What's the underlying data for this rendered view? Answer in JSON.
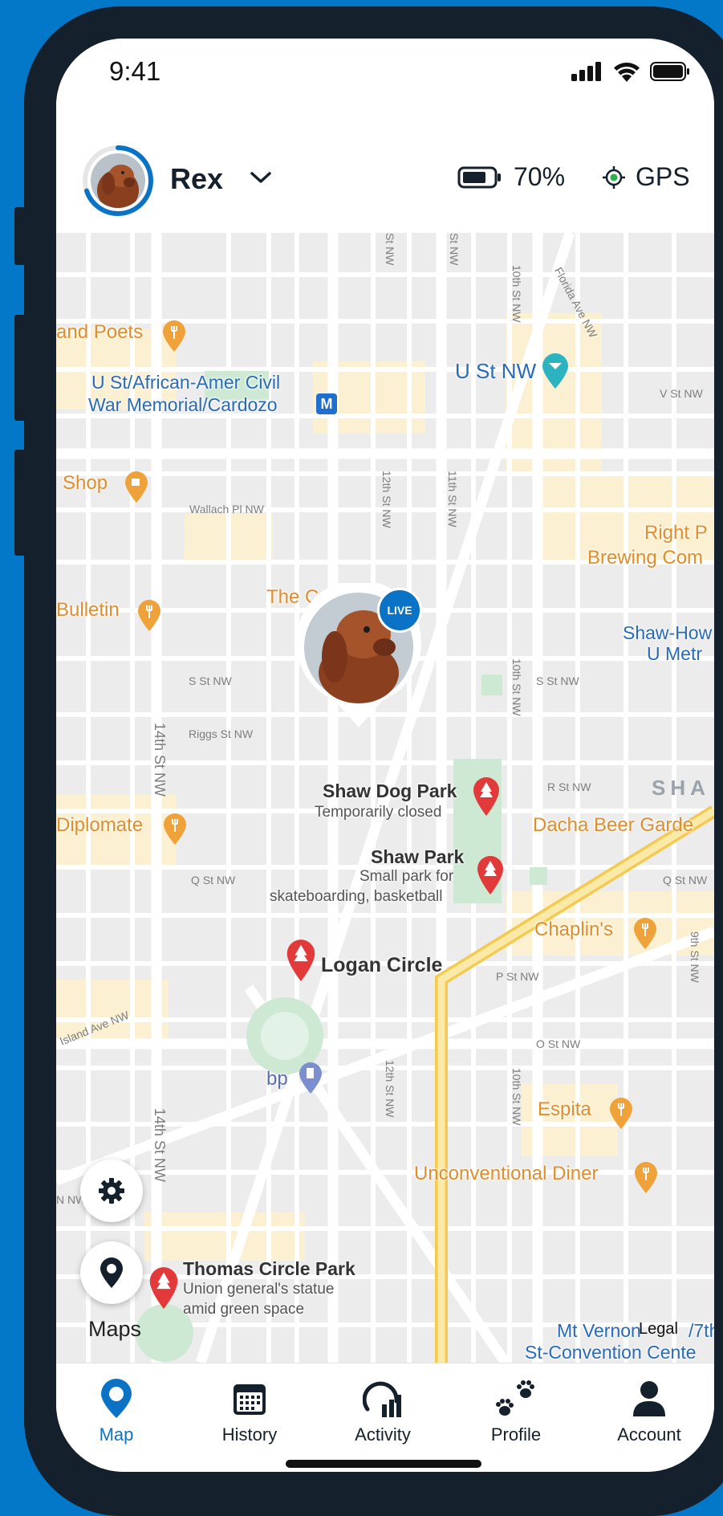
{
  "status": {
    "time": "9:41"
  },
  "header": {
    "pet_name": "Rex",
    "battery_text": "70%",
    "gps_text": "GPS"
  },
  "colors": {
    "accent": "#0b73c6",
    "frame": "#14202b",
    "poi": "#e08d2b",
    "pin": "#e23a3a"
  },
  "map": {
    "live_badge": "LIVE",
    "pois": {
      "poets": "and Poets",
      "shop": "Shop",
      "bulletin": "Bulletin",
      "the_c": "The C",
      "diplomate": "Diplomate",
      "right_proper_1": "Right P",
      "right_proper_2": "Brewing Com",
      "dacha": "Dacha Beer Garde",
      "chaplins": "Chaplin's",
      "espita": "Espita",
      "unconventional": "Unconventional Diner",
      "bp": "bp"
    },
    "transit": {
      "u_st_memorial_1": "U St/African-Amer Civil",
      "u_st_memorial_2": "War Memorial/Cardozo",
      "u_st_nw": "U St NW",
      "shaw_howard_1": "Shaw-How",
      "shaw_howard_2": "U Metr",
      "mt_vernon_1": "Mt Vernon",
      "mt_vernon_2": "St-Convention Cente",
      "seventh": "/7th"
    },
    "parks": {
      "shaw_dog_park": "Shaw Dog Park",
      "shaw_dog_park_sub": "Temporarily closed",
      "shaw_park": "Shaw Park",
      "shaw_park_sub_1": "Small park for",
      "shaw_park_sub_2": "skateboarding, basketball",
      "logan_circle": "Logan Circle",
      "thomas_circle": "Thomas Circle Park",
      "thomas_circle_sub_1": "Union general's statue",
      "thomas_circle_sub_2": "amid green space"
    },
    "neighborhood": "SHA",
    "streets": {
      "v_st": "V St NW",
      "wallach": "Wallach Pl NW",
      "s_st_left": "S St NW",
      "s_st_right": "S St NW",
      "riggs": "Riggs St NW",
      "r_st": "R St NW",
      "q_st_left": "Q St NW",
      "q_st_right": "Q St NW",
      "p_st": "P St NW",
      "o_st": "O St NW",
      "rhode_island": "Island Ave NW",
      "n_st": "N NW",
      "florida": "Florida Ave NW",
      "s13": "St NW",
      "s12top": "St NW",
      "tenth_top": "10th St NW",
      "twelfth": "12th St NW",
      "eleventh": "11th St NW",
      "tenth_mid": "10th St NW",
      "fourteenth": "14th St NW",
      "fourteenth_low": "14th St NW",
      "twelfth_low": "12th St NW",
      "tenth_low": "10th St NW",
      "ninth": "9th St NW"
    },
    "maps_label": "Maps",
    "legal_label": "Legal"
  },
  "tabs": [
    {
      "label": "Map",
      "icon": "map-pin-icon",
      "active": true
    },
    {
      "label": "History",
      "icon": "calendar-icon",
      "active": false
    },
    {
      "label": "Activity",
      "icon": "activity-gauge-icon",
      "active": false
    },
    {
      "label": "Profile",
      "icon": "paw-prints-icon",
      "active": false
    },
    {
      "label": "Account",
      "icon": "person-icon",
      "active": false
    }
  ]
}
